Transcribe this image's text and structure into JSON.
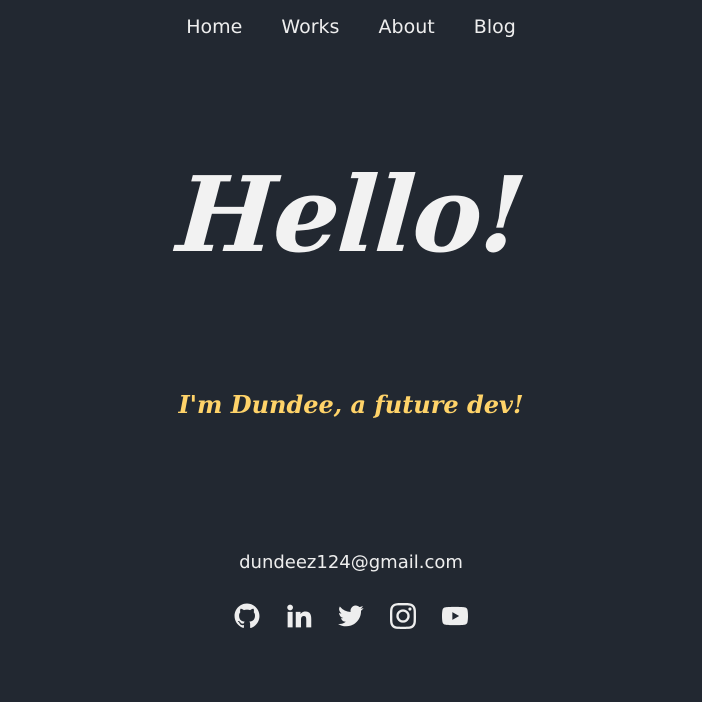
{
  "nav": {
    "items": [
      {
        "label": "Home"
      },
      {
        "label": "Works"
      },
      {
        "label": "About"
      },
      {
        "label": "Blog"
      }
    ]
  },
  "hero": {
    "greeting": "Hello!",
    "tagline": "I'm Dundee, a future dev!"
  },
  "contact": {
    "email": "dundeez124@gmail.com"
  },
  "socials": [
    {
      "icon": "github-icon"
    },
    {
      "icon": "linkedin-icon"
    },
    {
      "icon": "twitter-icon"
    },
    {
      "icon": "instagram-icon"
    },
    {
      "icon": "youtube-icon"
    }
  ],
  "colors": {
    "background": "#222831",
    "text": "#eeeeee",
    "accent": "#ffd369"
  }
}
